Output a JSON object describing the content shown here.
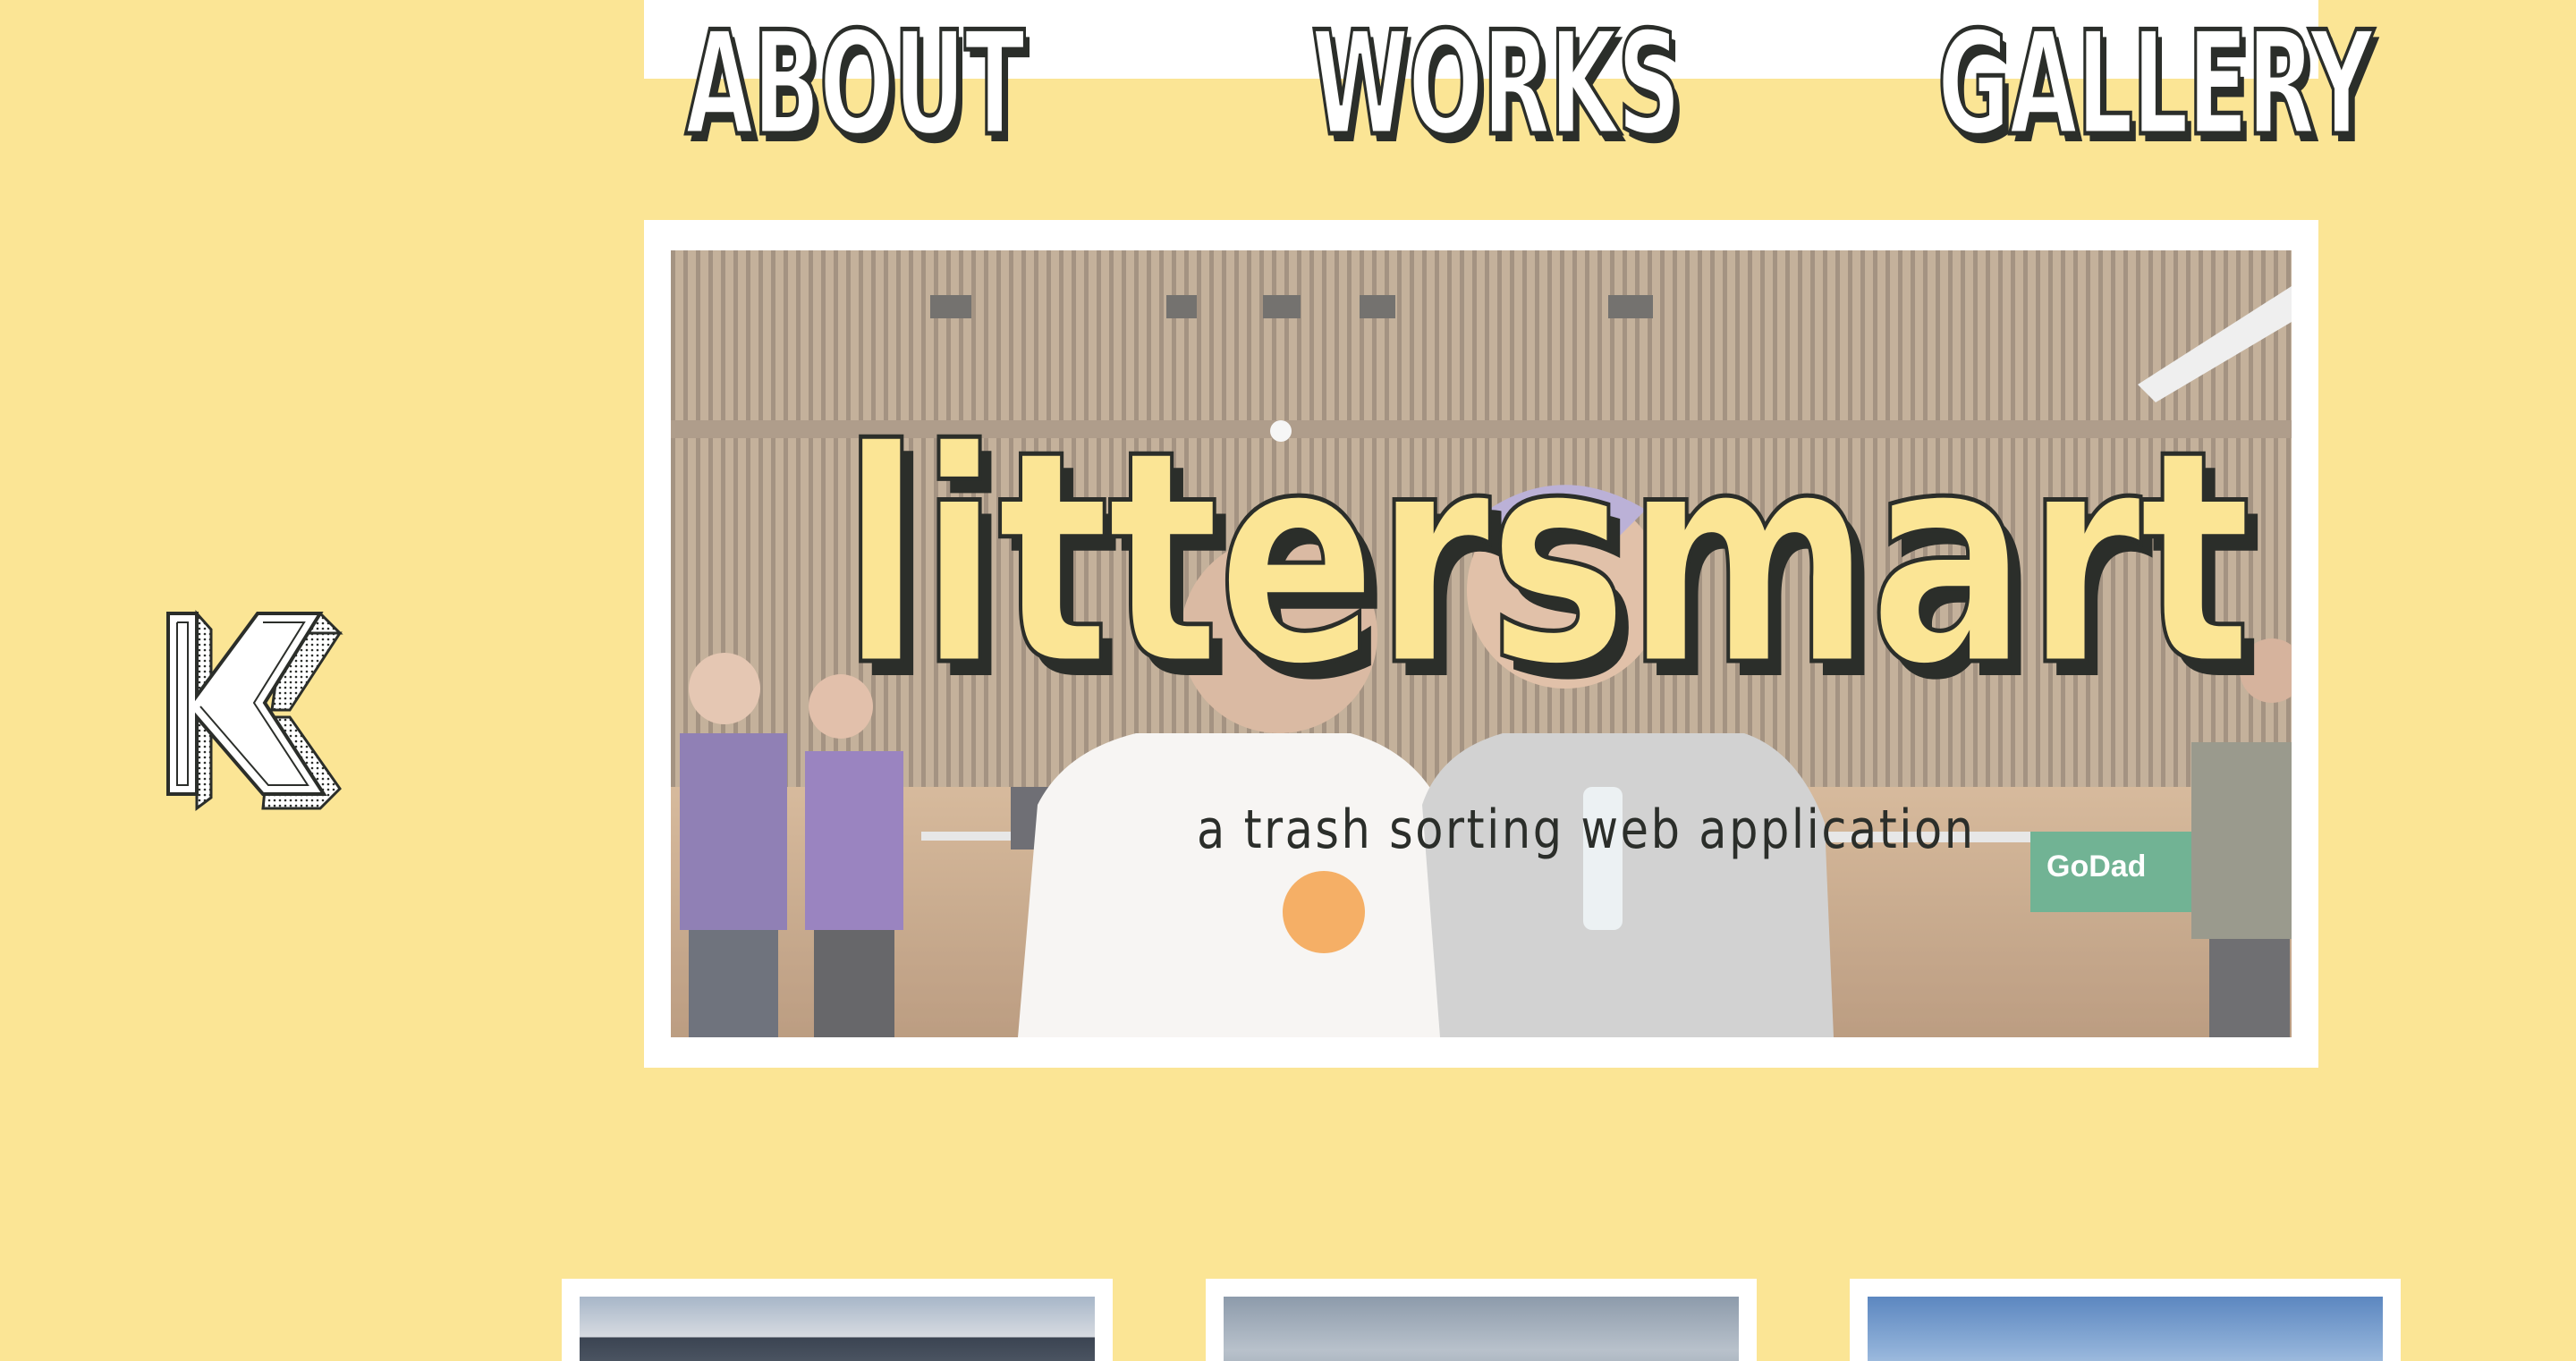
{
  "nav": {
    "about_label": "ABOUT",
    "works_label": "WORKS",
    "gallery_label": "GALLERY"
  },
  "logo": {
    "letter": "K",
    "icon": "k-monogram-logo"
  },
  "hero": {
    "title": "littersmart",
    "subtitle": "a trash sorting web application",
    "photo_badge": "GoDad"
  },
  "thumbnails": [
    {
      "icon": "mountain-landscape-photo"
    },
    {
      "icon": "cloudy-sky-photo"
    },
    {
      "icon": "blue-sky-photo"
    }
  ],
  "colors": {
    "background": "#fbe595",
    "accent_yellow": "#fbe595",
    "outline": "#2b2e2a",
    "card": "#ffffff"
  }
}
